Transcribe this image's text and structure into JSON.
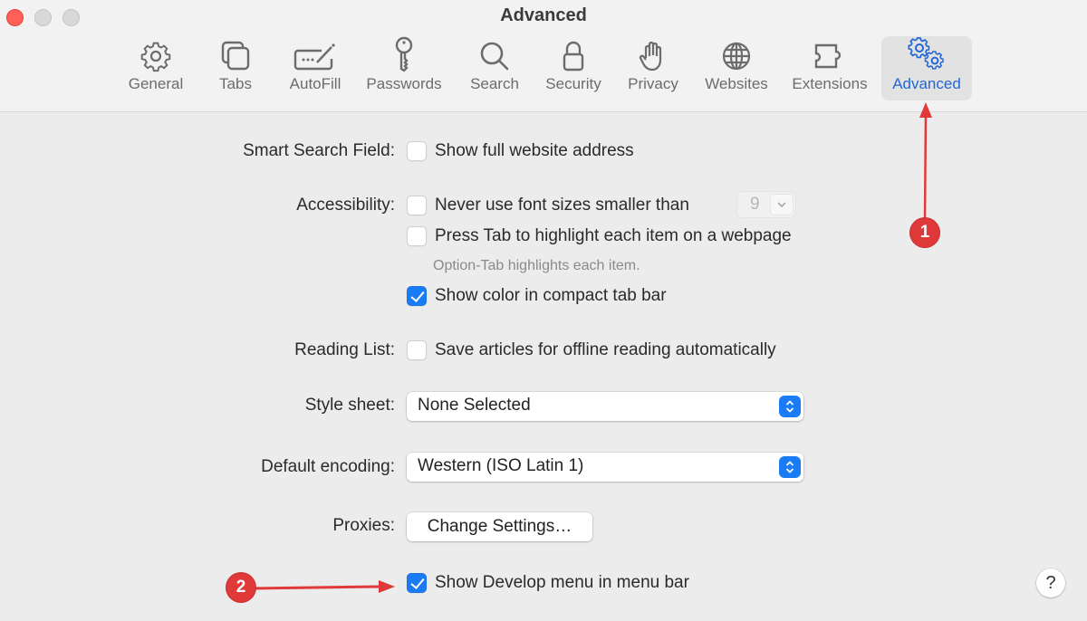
{
  "window": {
    "title": "Advanced",
    "traffic_lights": [
      "close",
      "minimize",
      "zoom"
    ]
  },
  "toolbar": {
    "items": [
      {
        "label": "General",
        "icon": "gear-icon",
        "active": false
      },
      {
        "label": "Tabs",
        "icon": "tabs-icon",
        "active": false
      },
      {
        "label": "AutoFill",
        "icon": "autofill-icon",
        "active": false
      },
      {
        "label": "Passwords",
        "icon": "key-icon",
        "active": false
      },
      {
        "label": "Search",
        "icon": "search-icon",
        "active": false
      },
      {
        "label": "Security",
        "icon": "lock-icon",
        "active": false
      },
      {
        "label": "Privacy",
        "icon": "hand-icon",
        "active": false
      },
      {
        "label": "Websites",
        "icon": "globe-icon",
        "active": false
      },
      {
        "label": "Extensions",
        "icon": "puzzle-icon",
        "active": false
      },
      {
        "label": "Advanced",
        "icon": "gears-icon",
        "active": true
      }
    ],
    "accent_color": "#2167d8"
  },
  "settings": {
    "smart_search": {
      "label": "Smart Search Field:",
      "show_full_address": {
        "text": "Show full website address",
        "checked": false
      }
    },
    "accessibility": {
      "label": "Accessibility:",
      "min_font": {
        "text": "Never use font sizes smaller than",
        "checked": false,
        "value": "9"
      },
      "press_tab": {
        "text": "Press Tab to highlight each item on a webpage",
        "checked": false
      },
      "press_tab_hint": "Option-Tab highlights each item.",
      "show_color": {
        "text": "Show color in compact tab bar",
        "checked": true
      }
    },
    "reading_list": {
      "label": "Reading List:",
      "save_offline": {
        "text": "Save articles for offline reading automatically",
        "checked": false
      }
    },
    "style_sheet": {
      "label": "Style sheet:",
      "value": "None Selected"
    },
    "default_encoding": {
      "label": "Default encoding:",
      "value": "Western (ISO Latin 1)"
    },
    "proxies": {
      "label": "Proxies:",
      "button": "Change Settings…"
    },
    "develop_menu": {
      "text": "Show Develop menu in menu bar",
      "checked": true
    },
    "help": "?"
  },
  "annotations": {
    "markers": [
      "1",
      "2"
    ],
    "color": "#e0393a"
  }
}
